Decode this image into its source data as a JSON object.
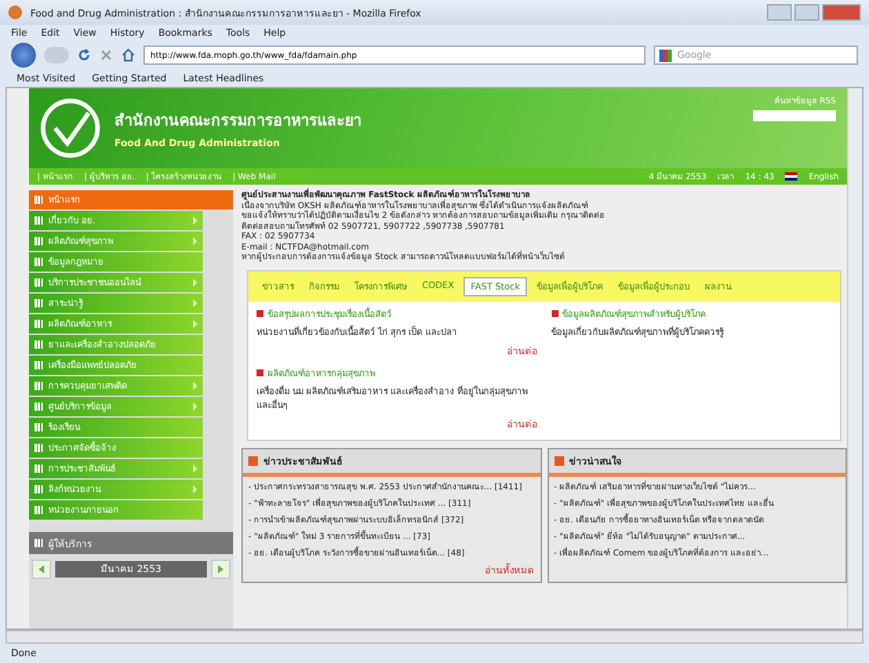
{
  "window": {
    "title": "Food and Drug Administration : สำนักงานคณะกรรมการอาหารและยา - Mozilla Firefox"
  },
  "menu": [
    "File",
    "Edit",
    "View",
    "History",
    "Bookmarks",
    "Tools",
    "Help"
  ],
  "address": {
    "value": "http://www.fda.moph.go.th/www_fda/fdamain.php"
  },
  "search": {
    "placeholder": "Google"
  },
  "bookmarks": [
    "Most Visited",
    "Getting Started",
    "Latest Headlines"
  ],
  "header": {
    "title": "สำนักงานคณะกรรมการอาหารและยา",
    "subtitle": "Food And Drug Administration",
    "link": "ค้นหาข้อมูล RSS"
  },
  "nav": {
    "items": [
      "| หน้าแรก",
      "| ผู้บริหาร อย.",
      "| โครงสร้างหน่วยงาน",
      "| Web Mail"
    ],
    "date": "4 มีนาคม 2553",
    "time_label": "เวลา",
    "time": "14 : 43",
    "language": "English"
  },
  "sidebar": {
    "items": [
      {
        "label": "หน้าแรก",
        "selected": true,
        "submenu": false
      },
      {
        "label": "เกี่ยวกับ อย.",
        "selected": false,
        "submenu": true
      },
      {
        "label": "ผลิตภัณฑ์สุขภาพ",
        "selected": false,
        "submenu": true
      },
      {
        "label": "ข้อมูลกฎหมาย",
        "selected": false,
        "submenu": false
      },
      {
        "label": "บริการประชาชนออนไลน์",
        "selected": false,
        "submenu": true
      },
      {
        "label": "สาระน่ารู้",
        "selected": false,
        "submenu": true
      },
      {
        "label": "ผลิตภัณฑ์อาหาร",
        "selected": false,
        "submenu": true
      },
      {
        "label": "ยาและเครื่องสำอางปลอดภัย",
        "selected": false,
        "submenu": false
      },
      {
        "label": "เครื่องมือแพทย์ปลอดภัย",
        "selected": false,
        "submenu": false
      },
      {
        "label": "การควบคุมยาเสพติด",
        "selected": false,
        "submenu": true
      },
      {
        "label": "ศูนย์บริการข้อมูล",
        "selected": false,
        "submenu": true
      },
      {
        "label": "ร้องเรียน",
        "selected": false,
        "submenu": false
      },
      {
        "label": "ประกาศจัดซื้อจ้าง",
        "selected": false,
        "submenu": false
      },
      {
        "label": "การประชาสัมพันธ์",
        "selected": false,
        "submenu": true
      },
      {
        "label": "ลิงก์หน่วยงาน",
        "selected": false,
        "submenu": true
      },
      {
        "label": "หน่วยงานภายนอก",
        "selected": false,
        "submenu": false
      }
    ],
    "service": "ผู้ให้บริการ",
    "calendar": "มีนาคม 2553"
  },
  "contact": {
    "heading": "ศูนย์ประสานงานเพื่อพัฒนาคุณภาพ FastStock ผลิตภัณฑ์อาหารในโรงพยาบาล",
    "lines": [
      "เนื่องจากบริษัท OKSH ผลิตภัณฑ์อาหารในโรงพยาบาลเพื่อสุขภาพ ซึ่งได้ดำเนินการแจ้งผลิตภัณฑ์",
      "ขอแจ้งให้ทราบว่าได้ปฏิบัติตามเงื่อนไข 2 ข้อดังกล่าว หากต้องการสอบถามข้อมูลเพิ่มเติม กรุณาติดต่อ",
      "ติดต่อสอบถามโทรศัพท์ 02 5907721, 5907722 ,5907738 ,5907781",
      "FAX : 02 5907734",
      "E-mail : NCTFDA@hotmail.com",
      "หากผู้ประกอบการต้องการแจ้งข้อมูล Stock สามารถดาวน์โหลดแบบฟอร์มได้ที่หน้าเว็บไซต์"
    ]
  },
  "tabs": [
    {
      "label": "ข่าวสาร",
      "selected": false
    },
    {
      "label": "กิจกรรม",
      "selected": false
    },
    {
      "label": "โครงการพิเศษ",
      "selected": false
    },
    {
      "label": "CODEX",
      "selected": false
    },
    {
      "label": "FAST Stock",
      "selected": true
    },
    {
      "label": "ข้อมูลเพื่อผู้บริโภค",
      "selected": false
    },
    {
      "label": "ข้อมูลเพื่อผู้ประกอบ",
      "selected": false
    },
    {
      "label": "ผลงาน",
      "selected": false
    }
  ],
  "articles": [
    {
      "title": "ข้อสรุปผลการประชุมเรื่องเนื้อสัตว์",
      "text": "หน่วยงานที่เกี่ยวข้องกับเนื้อสัตว์ ไก่ สุกร เป็ด และปลา",
      "more": "อ่านต่อ"
    },
    {
      "title": "ข้อมูลผลิตภัณฑ์สุขภาพสำหรับผู้บริโภค",
      "text": "ข้อมูลเกี่ยวกับผลิตภัณฑ์สุขภาพที่ผู้บริโภคควรรู้"
    },
    {
      "title": "ผลิตภัณฑ์อาหารกลุ่มสุขภาพ",
      "text": "เครื่องดื่ม นม ผลิตภัณฑ์เสริมอาหาร และเครื่องสำอาง ที่อยู่ในกลุ่มสุขภาพ และอื่นๆ",
      "more": "อ่านต่อ"
    }
  ],
  "news": {
    "title": "ข่าวประชาสัมพันธ์",
    "items": [
      "- ประกาศกระทรวงสาธารณสุข พ.ศ. 2553 ประกาศสำนักงานคณะ... [1411]",
      "- \"ฟ้าทะลายโจร\" เพื่อสุขภาพของผู้บริโภคในประเทศ ... [311]",
      "- การนำเข้าผลิตภัณฑ์สุขภาพผ่านระบบอิเล็กทรอนิกส์ [372]",
      "- \"ผลิตภัณฑ์\" ใหม่ 3 รายการที่ขึ้นทะเบียน ... [73]",
      "- อย. เตือนผู้บริโภค ระวังการซื้อขายผ่านอินเทอร์เน็ต... [48]"
    ],
    "more": "อ่านทั้งหมด"
  },
  "featured": {
    "title": "ข่าวน่าสนใจ",
    "items": [
      "- ผลิตภัณฑ์ เสริมอาหารที่ขายผ่านทางเว็บไซต์ \"ไม่ควร...",
      "- \"ผลิตภัณฑ์\" เพื่อสุขภาพของผู้บริโภคในประเทศไทย และอื่น",
      "- อย. เตือนภัย การซื้อยาทางอินเทอร์เน็ต หรือจากตลาดนัด",
      "- \"ผลิตภัณฑ์\" ยี่ห้อ \"ไม่ได้รับอนุญาต\" ตามประกาศ...",
      "- เพื่อผลิตภัณฑ์ Comem ของผู้บริโภคที่ต้องการ และอย่า..."
    ]
  },
  "status_bar": "Done"
}
